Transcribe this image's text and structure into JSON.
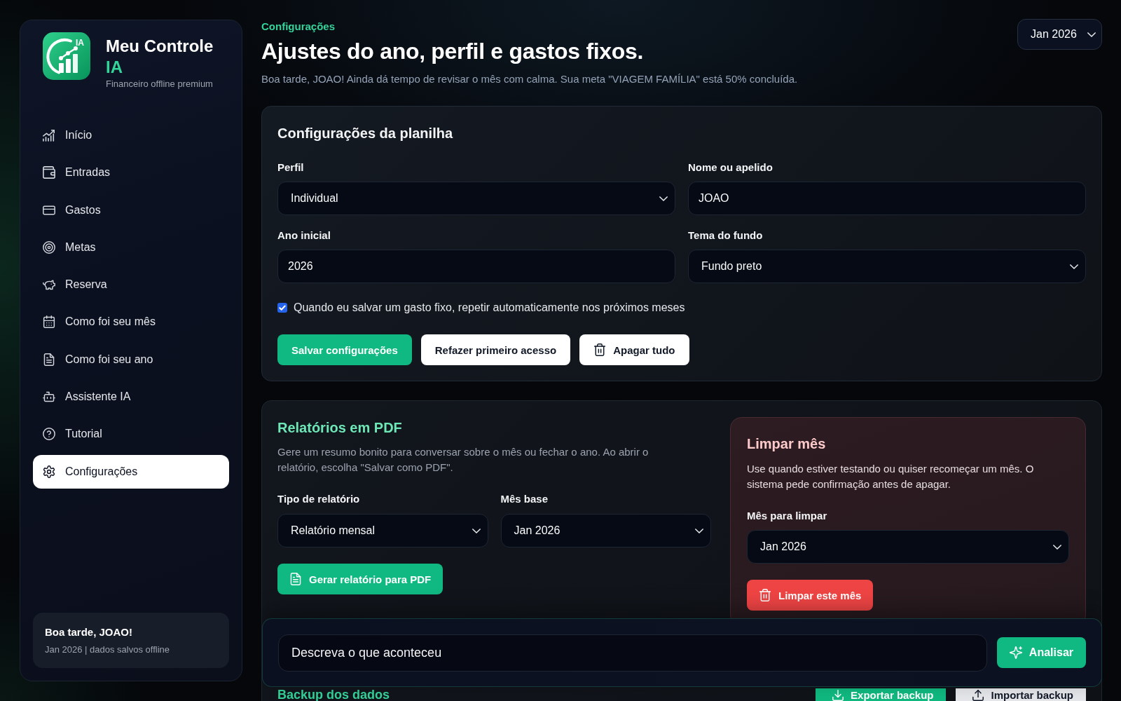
{
  "sidebar": {
    "logo_badge": "IA",
    "app_name": "Meu Controle",
    "app_name_accent": "IA",
    "tagline": "Financeiro offline premium",
    "items": [
      {
        "label": "Início",
        "selected": false
      },
      {
        "label": "Entradas",
        "selected": false
      },
      {
        "label": "Gastos",
        "selected": false
      },
      {
        "label": "Metas",
        "selected": false
      },
      {
        "label": "Reserva",
        "selected": false
      },
      {
        "label": "Como foi seu mês",
        "selected": false
      },
      {
        "label": "Como foi seu ano",
        "selected": false
      },
      {
        "label": "Assistente IA",
        "selected": false
      },
      {
        "label": "Tutorial",
        "selected": false
      },
      {
        "label": "Configurações",
        "selected": true
      }
    ],
    "status_card": {
      "greeting": "Boa tarde, JOAO!",
      "detail": "Jan 2026 | dados salvos offline"
    }
  },
  "header": {
    "kicker": "Configurações",
    "title": "Ajustes do ano, perfil e gastos fixos.",
    "subtitle": "Boa tarde, JOAO! Ainda dá tempo de revisar o mês com calma. Sua meta \"VIAGEM FAMÍLIA\" está 50% concluída.",
    "month_select": {
      "value": "Jan 2026"
    }
  },
  "settings": {
    "title": "Configurações da planilha",
    "fields": [
      {
        "label": "Perfil",
        "kind": "select",
        "value": "Individual"
      },
      {
        "label": "Nome ou apelido",
        "kind": "text",
        "value": "JOAO"
      },
      {
        "label": "Ano inicial",
        "kind": "text",
        "value": "2026"
      },
      {
        "label": "Tema do fundo",
        "kind": "select",
        "value": "Fundo preto"
      }
    ],
    "auto_repeat": {
      "label": "Quando eu salvar um gasto fixo, repetir automaticamente nos próximos meses",
      "checked": true
    },
    "buttons": [
      {
        "label": "Salvar configurações",
        "kind": "primary"
      },
      {
        "label": "Refazer primeiro acesso",
        "kind": "light"
      },
      {
        "label": "Apagar tudo",
        "kind": "light"
      }
    ]
  },
  "reports": {
    "title": "Relatórios em PDF",
    "description": "Gere um resumo bonito para conversar sobre o mês ou fechar o ano. Ao abrir o relatório, escolha \"Salvar como PDF\".",
    "fields": [
      {
        "label": "Tipo de relatório",
        "kind": "select",
        "value": "Relatório mensal"
      },
      {
        "label": "Mês base",
        "kind": "select",
        "value": "Jan 2026"
      }
    ],
    "button": {
      "label": "Gerar relatório para PDF",
      "kind": "primary"
    }
  },
  "clear_month": {
    "title": "Limpar mês",
    "description": "Use quando estiver testando ou quiser recomeçar um mês. O sistema pede confirmação antes de apagar.",
    "field": {
      "label": "Mês para limpar",
      "kind": "select",
      "value": "Jan 2026"
    },
    "button": {
      "label": "Limpar este mês",
      "kind": "danger"
    }
  },
  "backup": {
    "title": "Backup dos dados",
    "buttons": [
      {
        "label": "Exportar backup",
        "kind": "primary"
      },
      {
        "label": "Importar backup",
        "kind": "muted"
      }
    ]
  },
  "quick_entry": {
    "placeholder": "Descreva o que aconteceu",
    "button": {
      "label": "Analisar",
      "kind": "primary"
    }
  }
}
